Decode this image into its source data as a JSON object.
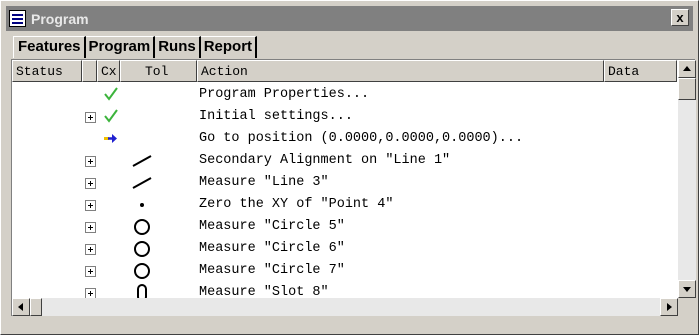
{
  "window": {
    "title": "Program",
    "icon": "program-list-icon",
    "close_label": "x"
  },
  "tabs": [
    {
      "label": "Features"
    },
    {
      "label": "Program"
    },
    {
      "label": "Runs"
    },
    {
      "label": "Report"
    }
  ],
  "columns": {
    "status": "Status",
    "blank": "",
    "cx": "Cx",
    "tol": "Tol",
    "action": "Action",
    "data": "Data"
  },
  "rows": [
    {
      "expandable": false,
      "cx": "checkmark-icon",
      "tol": "",
      "action": "Program Properties..."
    },
    {
      "expandable": true,
      "cx": "checkmark-icon",
      "tol": "",
      "action": "Initial settings..."
    },
    {
      "expandable": false,
      "cx": "right-arrow-icon",
      "tol": "",
      "action": "Go to position (0.0000,0.0000,0.0000)..."
    },
    {
      "expandable": true,
      "cx": "",
      "tol": "line-feature-icon",
      "action": "Secondary Alignment on \"Line 1\""
    },
    {
      "expandable": true,
      "cx": "",
      "tol": "line-feature-icon",
      "action": "Measure \"Line 3\""
    },
    {
      "expandable": true,
      "cx": "",
      "tol": "point-feature-icon",
      "action": "Zero the XY of \"Point 4\""
    },
    {
      "expandable": true,
      "cx": "",
      "tol": "circle-feature-icon",
      "action": "Measure \"Circle 5\""
    },
    {
      "expandable": true,
      "cx": "",
      "tol": "circle-feature-icon",
      "action": "Measure \"Circle 6\""
    },
    {
      "expandable": true,
      "cx": "",
      "tol": "circle-feature-icon",
      "action": "Measure \"Circle 7\""
    },
    {
      "expandable": true,
      "cx": "",
      "tol": "slot-feature-icon",
      "action": "Measure \"Slot 8\""
    }
  ],
  "colors": {
    "check": "#3cb43c",
    "arrow": "#2020d0",
    "arrow_tail": "#f0c000",
    "titlebar": "#808080",
    "face": "#d4d0c8"
  }
}
